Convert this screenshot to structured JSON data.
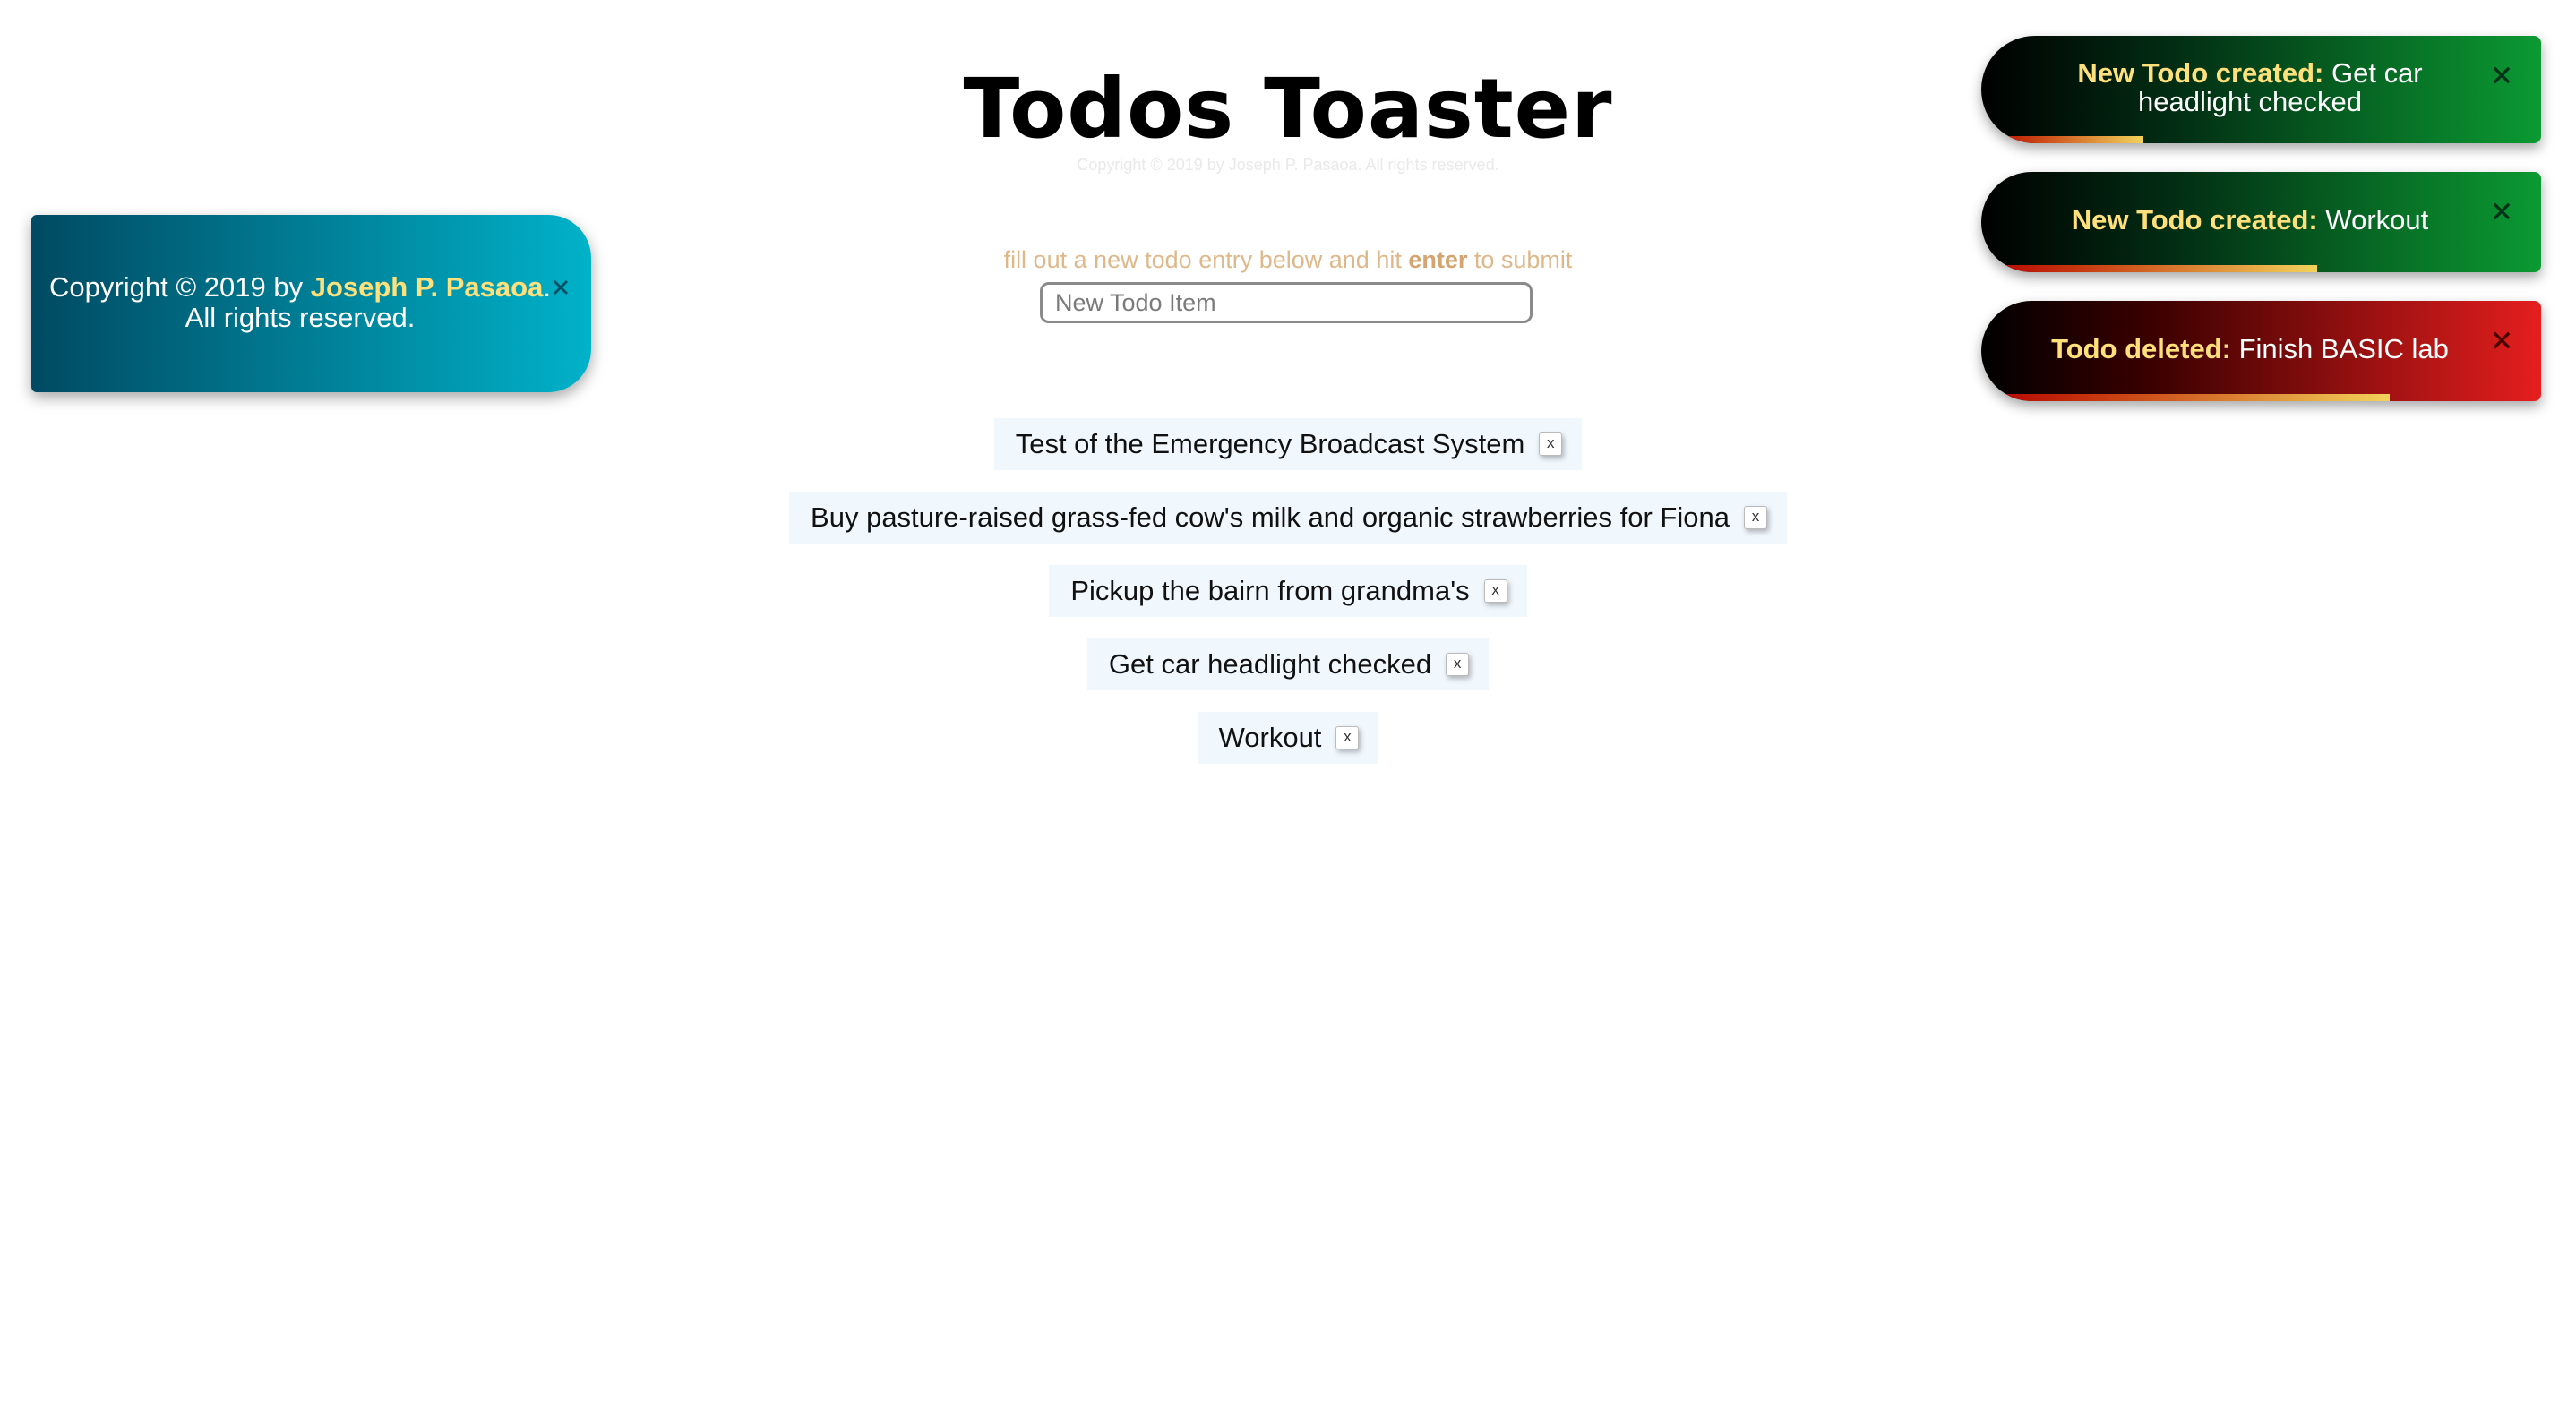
{
  "header": {
    "title": "Todos Toaster",
    "copyright_small": "Copyright © 2019 by Joseph P. Pasaoa. All rights reserved."
  },
  "form": {
    "instruction_prefix": "fill out a new todo entry below and hit ",
    "instruction_key": "enter",
    "instruction_suffix": " to submit",
    "input_placeholder": "New Todo Item",
    "input_value": ""
  },
  "todos": [
    {
      "text": "Test of the Emergency Broadcast System",
      "delete_label": "x"
    },
    {
      "text": "Buy pasture-raised grass-fed cow's milk and organic strawberries for Fiona",
      "delete_label": "x"
    },
    {
      "text": "Pickup the bairn from grandma's",
      "delete_label": "x"
    },
    {
      "text": "Get car headlight checked",
      "delete_label": "x"
    },
    {
      "text": "Workout",
      "delete_label": "x"
    }
  ],
  "copyright_toast": {
    "prefix": "Copyright © 2019 by ",
    "author": "Joseph P. Pasaoa",
    "suffix": ".",
    "line2": "All rights reserved.",
    "close_icon": "close-x-icon",
    "background_start": "#004a62",
    "background_end": "#00b2c9"
  },
  "toasts": [
    {
      "kind": "created",
      "lead": "New Todo created:",
      "text": " Get car headlight checked",
      "progress": 0.29
    },
    {
      "kind": "created",
      "lead": "New Todo created:",
      "text": " Workout",
      "progress": 0.6
    },
    {
      "kind": "deleted",
      "lead": "Todo deleted:",
      "text": " Finish BASIC lab",
      "progress": 0.73
    }
  ],
  "colors": {
    "created_accent": "#0b9a32",
    "deleted_accent": "#e51e1e",
    "lead_text": "#ffe07a",
    "instruction_text": "#dfb88a",
    "todo_bg": "#f0f7fd"
  }
}
